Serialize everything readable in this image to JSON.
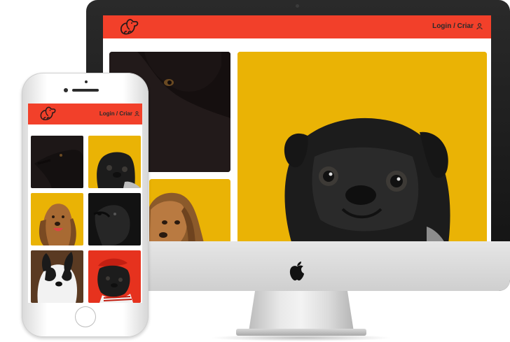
{
  "site": {
    "login_label": "Login / Criar",
    "logo_icon": "dog-logo-icon",
    "user_icon": "user-icon"
  },
  "colors": {
    "header": "#f2402a",
    "yellow": "#eab305",
    "dark": "#221a1a",
    "red": "#e6321e"
  },
  "desktop": {
    "photos": [
      "black-dog",
      "pug",
      "afghan-hound"
    ]
  },
  "mobile": {
    "photos": [
      "black-dog",
      "pug",
      "afghan-hound",
      "dark-dog",
      "french-bulldog",
      "pug-red-hat"
    ]
  },
  "device": {
    "desktop_logo_icon": "apple-logo-icon"
  }
}
